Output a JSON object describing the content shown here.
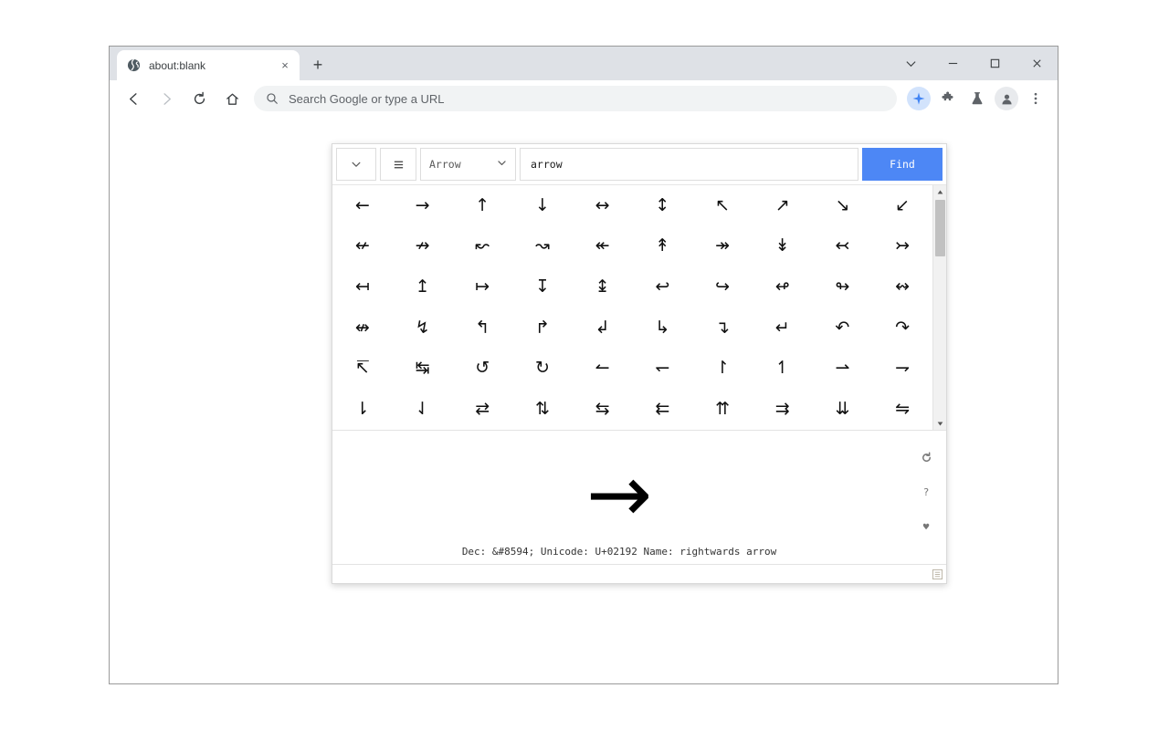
{
  "browser": {
    "tab": {
      "title": "about:blank",
      "favicon": "globe-icon",
      "close_label": "×"
    },
    "new_tab_label": "+",
    "window_controls": [
      {
        "name": "chevron-down",
        "glyph": "⌄"
      },
      {
        "name": "minimize",
        "glyph": "–"
      },
      {
        "name": "maximize",
        "glyph": "□"
      },
      {
        "name": "close",
        "glyph": "✕"
      }
    ],
    "nav": {
      "back_label": "←",
      "forward_label": "→",
      "reload_label": "⟳",
      "home_label": "⌂"
    },
    "omnibox": {
      "icon": "search-icon",
      "placeholder": "Search Google or type a URL",
      "value": ""
    },
    "toolbar_icons": [
      {
        "name": "gemini-sparkle-icon",
        "glyph": "✚"
      },
      {
        "name": "extensions-puzzle-icon",
        "glyph": "❖"
      },
      {
        "name": "labs-flask-icon",
        "glyph": "⚗"
      },
      {
        "name": "profile-avatar-icon",
        "glyph": "●"
      },
      {
        "name": "more-menu-icon",
        "glyph": "⋮"
      }
    ]
  },
  "charmap": {
    "toolbar": {
      "collapse_label": "⌄",
      "menu_label": "☰",
      "category_select": {
        "value": "Arrow",
        "caret": "⌄",
        "options": [
          "Arrow"
        ]
      },
      "search_input": {
        "value": "arrow",
        "placeholder": ""
      },
      "find_button_label": "Find",
      "find_button_color": "#4d87f5"
    },
    "grid": {
      "columns": 10,
      "rows": 6,
      "characters": [
        "←",
        "→",
        "↑",
        "↓",
        "↔",
        "↕",
        "↖",
        "↗",
        "↘",
        "↙",
        "↚",
        "↛",
        "↜",
        "↝",
        "↞",
        "↟",
        "↠",
        "↡",
        "↢",
        "↣",
        "↤",
        "↥",
        "↦",
        "↧",
        "↨",
        "↩",
        "↪",
        "↫",
        "↬",
        "↭",
        "↮",
        "↯",
        "↰",
        "↱",
        "↲",
        "↳",
        "↴",
        "↵",
        "↶",
        "↷",
        "↸",
        "↹",
        "↺",
        "↻",
        "↼",
        "↽",
        "↾",
        "↿",
        "⇀",
        "⇁",
        "⇂",
        "⇃",
        "⇄",
        "⇅",
        "⇆",
        "⇇",
        "⇈",
        "⇉",
        "⇊",
        "⇋"
      ]
    },
    "scrollbar": {
      "up_arrow": "▲",
      "down_arrow": "▼"
    },
    "preview": {
      "character": "→",
      "info": "Dec: &#8594; Unicode: U+02192 Name: rightwards arrow"
    },
    "rail_icons": [
      {
        "name": "refresh-icon",
        "glyph": "↺"
      },
      {
        "name": "help-icon",
        "glyph": "?"
      },
      {
        "name": "favorite-heart-icon",
        "glyph": "♥"
      }
    ],
    "statusbar": {
      "resize_handle": "▤"
    }
  }
}
